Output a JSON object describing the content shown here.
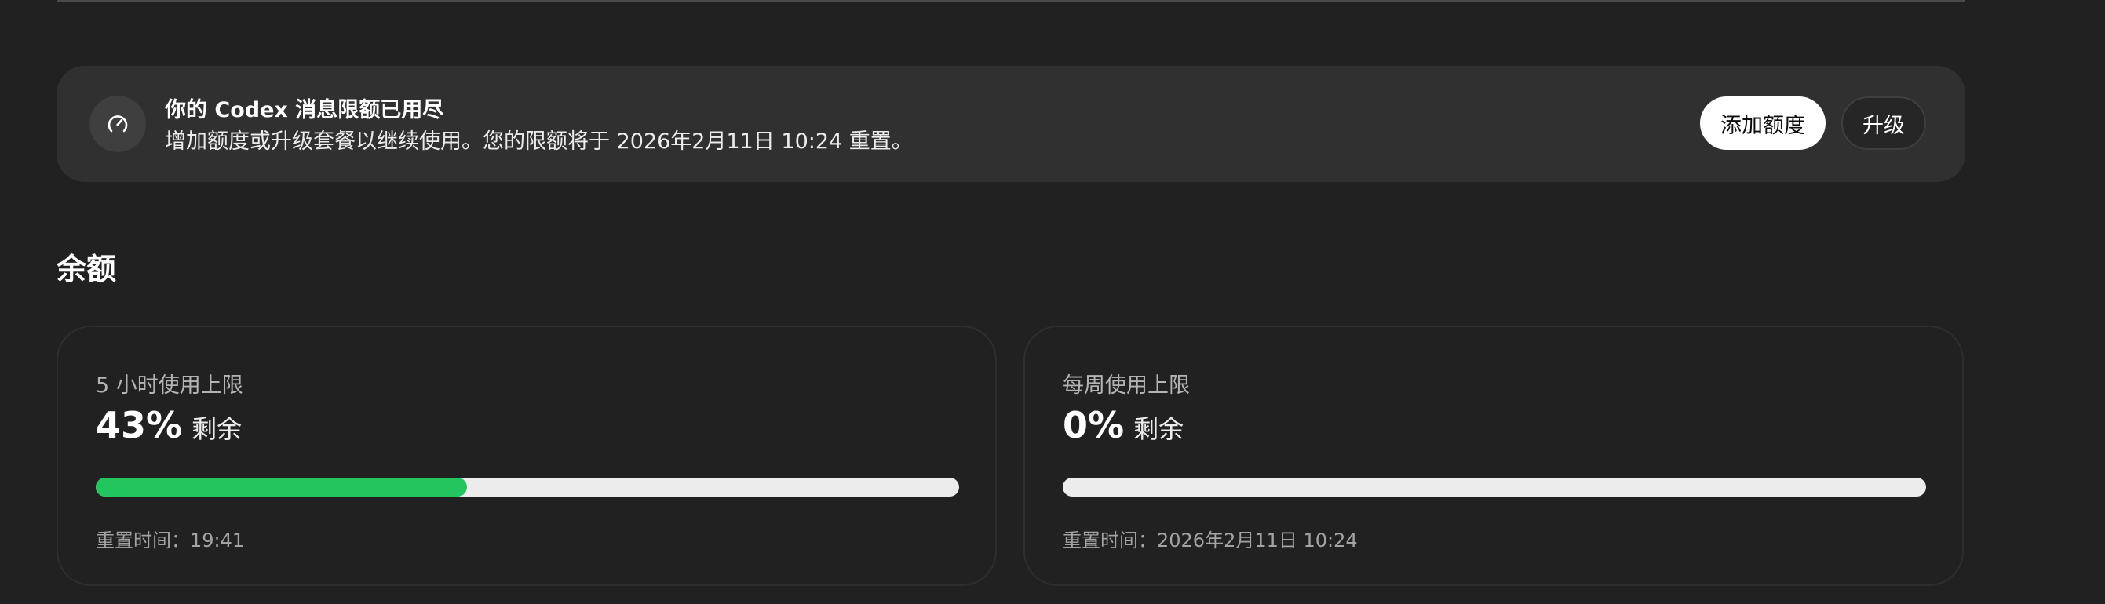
{
  "banner": {
    "title": "你的 Codex 消息限额已用尽",
    "description": "增加额度或升级套餐以继续使用。您的限额将于 2026年2月11日 10:24 重置。",
    "add_credits_label": "添加额度",
    "upgrade_label": "升级",
    "icon": "gauge-icon"
  },
  "balance": {
    "heading": "余额",
    "cards": [
      {
        "label": "5 小时使用上限",
        "percent": "43%",
        "remaining_label": "剩余",
        "progress_fraction": 0.43,
        "reset_text": "重置时间：19:41"
      },
      {
        "label": "每周使用上限",
        "percent": "0%",
        "remaining_label": "剩余",
        "progress_fraction": 0.0,
        "reset_text": "重置时间：2026年2月11日 10:24"
      }
    ]
  },
  "colors": {
    "background": "#212121",
    "banner_background": "#303030",
    "progress_fill": "#22c55e",
    "progress_track": "#ececec"
  }
}
